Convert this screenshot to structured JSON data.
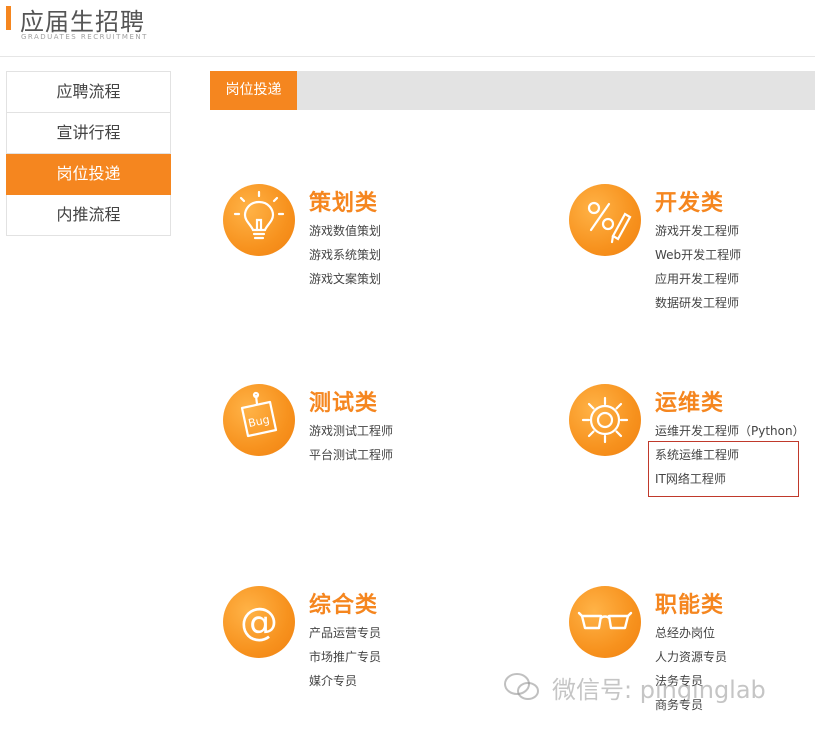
{
  "header": {
    "title": "应届生招聘",
    "subtitle": "GRADUATES RECRUITMENT"
  },
  "sidebar": {
    "items": [
      {
        "label": "应聘流程"
      },
      {
        "label": "宣讲行程"
      },
      {
        "label": "岗位投递"
      },
      {
        "label": "内推流程"
      }
    ]
  },
  "tab": {
    "active_label": "岗位投递"
  },
  "categories": [
    {
      "title": "策划类",
      "icon": "lightbulb-icon",
      "jobs": [
        "游戏数值策划",
        "游戏系统策划",
        "游戏文案策划"
      ]
    },
    {
      "title": "开发类",
      "icon": "percent-pencil-icon",
      "jobs": [
        "游戏开发工程师",
        "Web开发工程师",
        "应用开发工程师",
        "数据研发工程师"
      ]
    },
    {
      "title": "测试类",
      "icon": "bug-note-icon",
      "jobs": [
        "游戏测试工程师",
        "平台测试工程师"
      ]
    },
    {
      "title": "运维类",
      "icon": "gear-icon",
      "jobs": [
        "运维开发工程师（Python）",
        "系统运维工程师",
        "IT网络工程师"
      ]
    },
    {
      "title": "综合类",
      "icon": "at-icon",
      "jobs": [
        "产品运营专员",
        "市场推广专员",
        "媒介专员"
      ]
    },
    {
      "title": "职能类",
      "icon": "glasses-icon",
      "jobs": [
        "总经办岗位",
        "人力资源专员",
        "法务专员",
        "商务专员"
      ]
    }
  ],
  "watermark": {
    "text": "微信号: pinginglab"
  },
  "colors": {
    "accent": "#f5861f",
    "tabbar": "#e3e3e3",
    "highlight_box": "#c0392b"
  }
}
